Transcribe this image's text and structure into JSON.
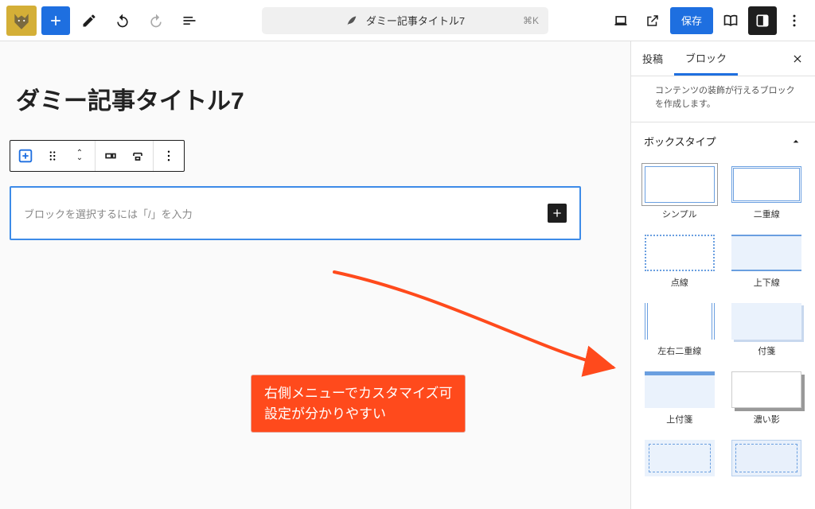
{
  "topbar": {
    "doc_title": "ダミー記事タイトル7",
    "shortcut": "⌘K",
    "save_label": "保存"
  },
  "editor": {
    "post_title": "ダミー記事タイトル7",
    "block_placeholder": "ブロックを選択するには「/」を入力"
  },
  "annotation": {
    "line1": "右側メニューでカスタマイズ可",
    "line2": "設定が分かりやすい"
  },
  "sidebar": {
    "tabs": {
      "post": "投稿",
      "block": "ブロック"
    },
    "description": "コンテンツの装飾が行えるブロックを作成します。",
    "section_title": "ボックスタイプ",
    "box_types": [
      {
        "label": "シンプル",
        "cls": "bp-simple",
        "selected": true
      },
      {
        "label": "二重線",
        "cls": "bp-double"
      },
      {
        "label": "点線",
        "cls": "bp-dotted"
      },
      {
        "label": "上下線",
        "cls": "bp-topbot"
      },
      {
        "label": "左右二重線",
        "cls": "bp-lrdbl"
      },
      {
        "label": "付箋",
        "cls": "bp-sticky"
      },
      {
        "label": "上付箋",
        "cls": "bp-topsticky"
      },
      {
        "label": "濃い影",
        "cls": "bp-shadow"
      },
      {
        "label": "",
        "cls": "bp-dashin"
      },
      {
        "label": "",
        "cls": "bp-dashin2"
      }
    ]
  }
}
